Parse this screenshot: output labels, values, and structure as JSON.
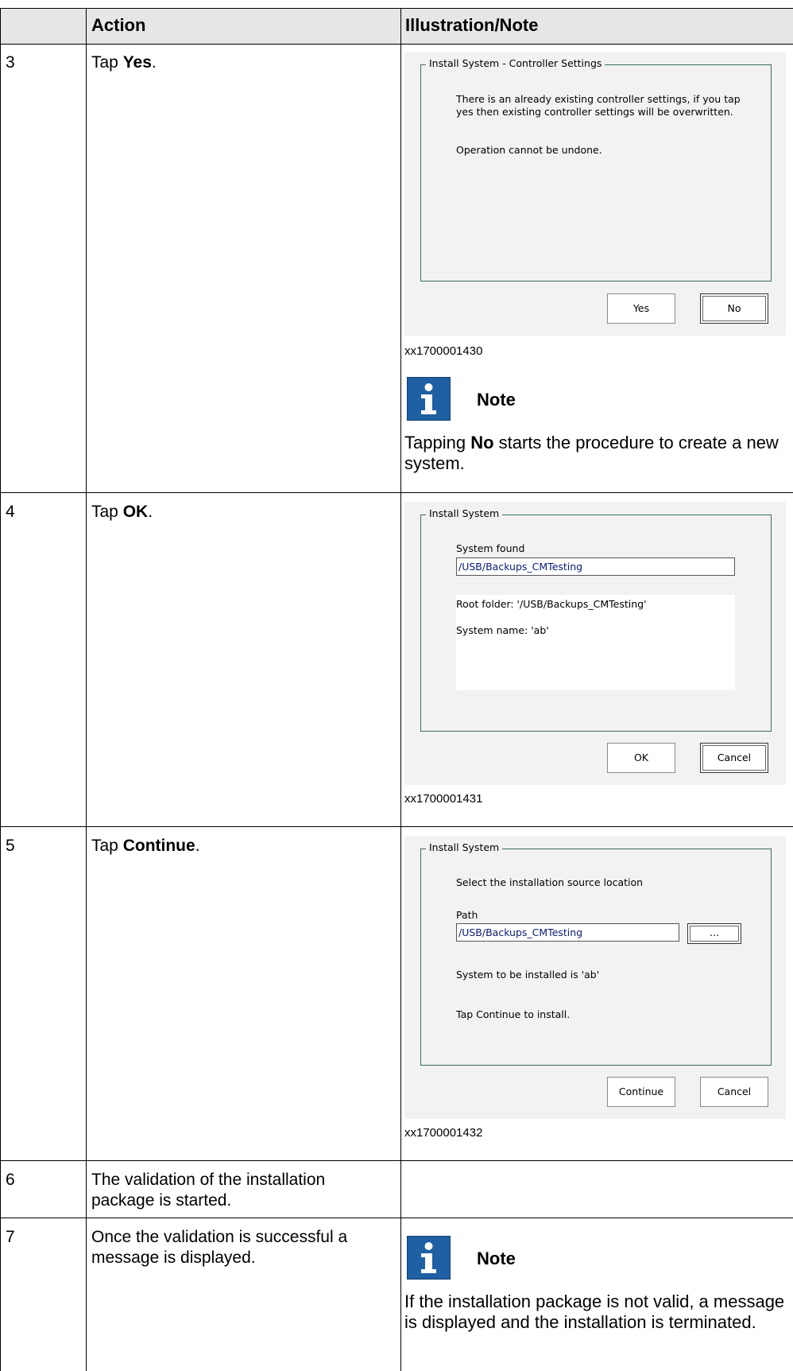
{
  "table": {
    "headers": [
      "",
      "Action",
      "Illustration/Note"
    ]
  },
  "rows": [
    {
      "step": "3",
      "action": {
        "pre": "Tap ",
        "bold": "Yes",
        "post": "."
      },
      "dialog": {
        "title": "Install System - Controller Settings",
        "message_line1": "There is an already existing controller settings, if you tap",
        "message_line2": "yes then existing controller settings will be overwritten.",
        "message2": "Operation cannot be undone.",
        "buttons": [
          "Yes",
          "No"
        ]
      },
      "caption": "xx1700001430",
      "note": {
        "title": "Note",
        "text_pre": "Tapping ",
        "text_bold": "No",
        "text_post": " starts the procedure to create a new system."
      }
    },
    {
      "step": "4",
      "action": {
        "pre": "Tap ",
        "bold": "OK",
        "post": "."
      },
      "dialog": {
        "title": "Install System",
        "label": "System found",
        "field_value": "/USB/Backups_CMTesting",
        "info_line1": "Root folder: '/USB/Backups_CMTesting'",
        "info_line2": "System name: 'ab'",
        "buttons": [
          "OK",
          "Cancel"
        ]
      },
      "caption": "xx1700001431"
    },
    {
      "step": "5",
      "action": {
        "pre": "Tap ",
        "bold": "Continue",
        "post": "."
      },
      "dialog": {
        "title": "Install System",
        "label": "Select the installation source location",
        "path_label": "Path",
        "field_value": "/USB/Backups_CMTesting",
        "browse_label": "...",
        "line1": "System to be installed is 'ab'",
        "line2": "Tap Continue to install.",
        "buttons": [
          "Continue",
          "Cancel"
        ]
      },
      "caption": "xx1700001432"
    },
    {
      "step": "6",
      "action_line1": "The validation of the installation",
      "action_line2": "package is started."
    },
    {
      "step": "7",
      "action_line1": "Once the validation is successful a",
      "action_line2": "message is displayed.",
      "note": {
        "title": "Note",
        "text": "If the installation package is not valid, a message is displayed and the installation is terminated."
      }
    }
  ]
}
